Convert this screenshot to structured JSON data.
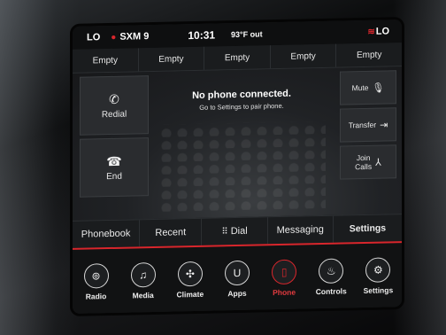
{
  "status": {
    "climate_left": "LO",
    "radio_station": "SXM 9",
    "time": "10:31",
    "outside_temp": "93°F out",
    "climate_right": "LO"
  },
  "favorites": [
    "Empty",
    "Empty",
    "Empty",
    "Empty",
    "Empty"
  ],
  "phone": {
    "redial_label": "Redial",
    "end_label": "End",
    "message_title": "No phone connected.",
    "message_sub": "Go to Settings to pair phone.",
    "mute_label": "Mute",
    "transfer_label": "Transfer",
    "join_label_1": "Join",
    "join_label_2": "Calls"
  },
  "tabs": {
    "phonebook": "Phonebook",
    "recent": "Recent",
    "dial": "Dial",
    "messaging": "Messaging",
    "settings": "Settings"
  },
  "dock": [
    {
      "label": "Radio",
      "icon": "radio-tower-icon"
    },
    {
      "label": "Media",
      "icon": "music-note-icon"
    },
    {
      "label": "Climate",
      "icon": "fan-icon"
    },
    {
      "label": "Apps",
      "icon": "apps-icon"
    },
    {
      "label": "Phone",
      "icon": "phone-icon"
    },
    {
      "label": "Controls",
      "icon": "seat-icon"
    },
    {
      "label": "Settings",
      "icon": "gear-icon"
    }
  ],
  "colors": {
    "accent": "#d8262c",
    "panel": "#2a2c2f",
    "background": "#1c1e20"
  }
}
